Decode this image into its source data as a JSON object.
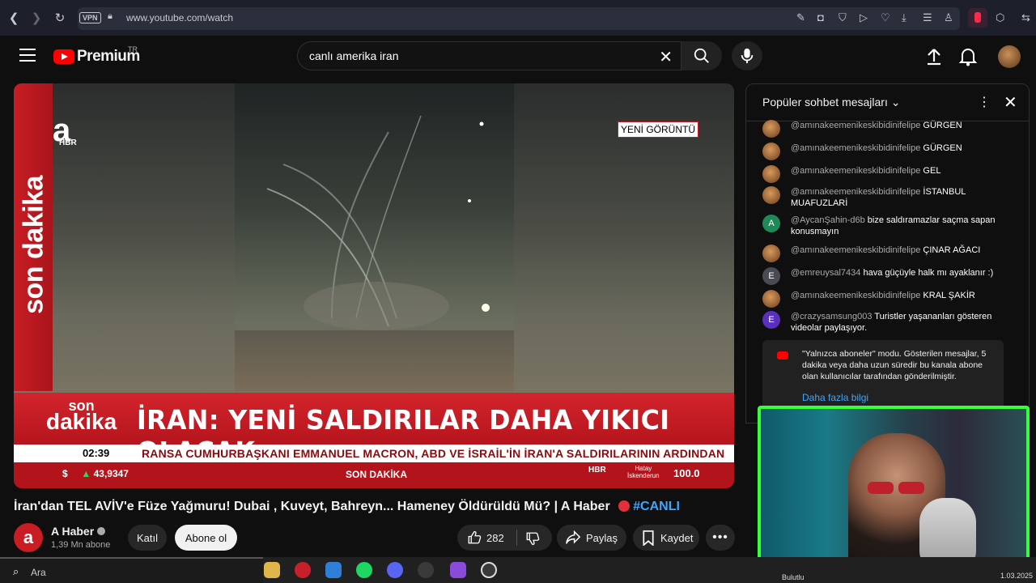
{
  "browser": {
    "vpn_label": "VPN",
    "url": "www.youtube.com/watch"
  },
  "header": {
    "logo_text": "Premium",
    "logo_region": "TR",
    "search_value": "canlı amerika iran"
  },
  "video": {
    "side_text": "son dakika",
    "logo_sub": "HBR",
    "new_tag": "YENİ GÖRÜNTÜ",
    "son_dakika_top": "son",
    "son_dakika_bottom": "dakika",
    "headline": "İRAN: YENİ SALDIRILAR DAHA YIKICI OLACAK",
    "time": "02:39",
    "crawl": "RANSA CUMHURBAŞKANI EMMANUEL MACRON, ABD VE İSRAİL'İN İRAN'A SALDIRILARININ ARDINDAN",
    "currency_symbol": "$",
    "currency_arrow": "▲",
    "currency_value": "43,9347",
    "bottom_label": "SON DAKİKA",
    "radio_label": "HBR",
    "location_line1": "Hatay",
    "location_line2": "İskenderun",
    "frequency": "100.0"
  },
  "title": {
    "text": "İran'dan TEL AVİV'e Füze Yağmuru! Dubai , Kuveyt, Bahreyn... Hameney Öldürüldü Mü? | A Haber",
    "live_tag": "#CANLI"
  },
  "channel": {
    "name": "A Haber",
    "subs": "1,39 Mn abone",
    "join_label": "Katıl",
    "subscribe_label": "Abone ol"
  },
  "actions": {
    "like_count": "282",
    "share_label": "Paylaş",
    "save_label": "Kaydet"
  },
  "chat": {
    "title": "Popüler sohbet mesajları",
    "messages": [
      {
        "author": "@amınakeemenikeskibidinifelipe",
        "text": "GÜRGEN",
        "avatar": "photo"
      },
      {
        "author": "@amınakeemenikeskibidinifelipe",
        "text": "GÜRGEN",
        "avatar": "photo"
      },
      {
        "author": "@amınakeemenikeskibidinifelipe",
        "text": "GEL",
        "avatar": "photo"
      },
      {
        "author": "@amınakeemenikeskibidinifelipe",
        "text": "İSTANBUL MUAFUZLARİ",
        "avatar": "photo"
      },
      {
        "author": "@AycanŞahin-d6b",
        "text": "bize saldıramazlar saçma sapan konusmayın",
        "avatar": "A"
      },
      {
        "author": "@amınakeemenikeskibidinifelipe",
        "text": "ÇINAR AĞACI",
        "avatar": "photo"
      },
      {
        "author": "@emreuysal7434",
        "text": "hava güçüyle halk mı ayaklanır :)",
        "avatar": "E"
      },
      {
        "author": "@amınakeemenikeskibidinifelipe",
        "text": "KRAL ŞAKİR",
        "avatar": "photo"
      },
      {
        "author": "@crazysamsung003",
        "text": "Turistler yaşananları gösteren videolar paylaşıyor.",
        "avatar": "E"
      }
    ],
    "notice": "\"Yalnızca aboneler\" modu. Gösterilen mesajlar, 5 dakika veya daha uzun süredir bu kanala abone olan kullanıcılar tarafından gönderilmiştir.",
    "notice_link": "Daha fazla bilgi"
  },
  "taskbar": {
    "search_placeholder": "Ara",
    "date": "1.03.2025",
    "badge": "Bulutlu"
  },
  "colors": {
    "accent": "#ff0000",
    "link": "#3ea6ff",
    "news_red": "#c81d24",
    "cam_border": "#34ff3a"
  }
}
